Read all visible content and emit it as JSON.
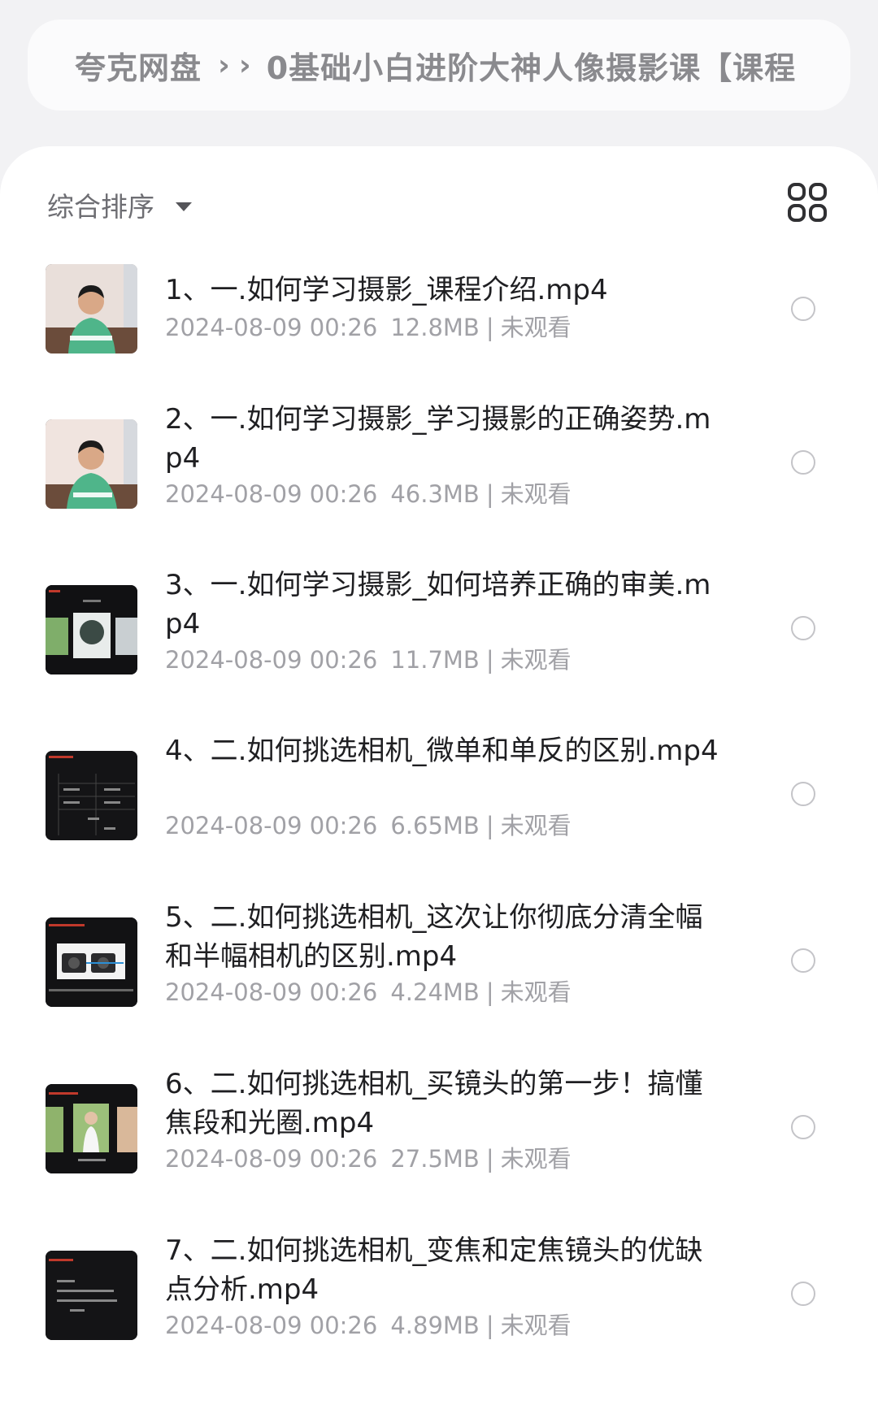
{
  "breadcrumb": {
    "root": "夸克网盘",
    "separator": "›",
    "current": "0基础小白进阶大神人像摄影课【课程"
  },
  "toolbar": {
    "sort_label": "综合排序",
    "sort_icon": "caret-down-icon",
    "view_icon": "grid-view-icon"
  },
  "files": [
    {
      "name": "1、一.如何学习摄影_课程介绍.mp4",
      "date": "2024-08-09 00:26",
      "size": "12.8MB",
      "status": "未观看",
      "thumb": "person-video"
    },
    {
      "name": "2、一.如何学习摄影_学习摄影的正确姿势.mp4",
      "date": "2024-08-09 00:26",
      "size": "46.3MB",
      "status": "未观看",
      "thumb": "person-video"
    },
    {
      "name": "3、一.如何学习摄影_如何培养正确的审美.mp4",
      "date": "2024-08-09 00:26",
      "size": "11.7MB",
      "status": "未观看",
      "thumb": "slide-photos"
    },
    {
      "name": "4、二.如何挑选相机_微单和单反的区别.mp4",
      "date": "2024-08-09 00:26",
      "size": "6.65MB",
      "status": "未观看",
      "thumb": "slide-table"
    },
    {
      "name": "5、二.如何挑选相机_这次让你彻底分清全幅和半幅相机的区别.mp4",
      "date": "2024-08-09 00:26",
      "size": "4.24MB",
      "status": "未观看",
      "thumb": "slide-camera"
    },
    {
      "name": "6、二.如何挑选相机_买镜头的第一步！搞懂焦段和光圈.mp4",
      "date": "2024-08-09 00:26",
      "size": "27.5MB",
      "status": "未观看",
      "thumb": "slide-portraits"
    },
    {
      "name": "7、二.如何挑选相机_变焦和定焦镜头的优缺点分析.mp4",
      "date": "2024-08-09 00:26",
      "size": "4.89MB",
      "status": "未观看",
      "thumb": "slide-text"
    }
  ],
  "colors": {
    "page_bg": "#f2f2f4",
    "card_bg": "#ffffff",
    "title_text": "#1f1f22",
    "meta_text": "#a1a1a6",
    "radio_border": "#c4c4c8"
  }
}
